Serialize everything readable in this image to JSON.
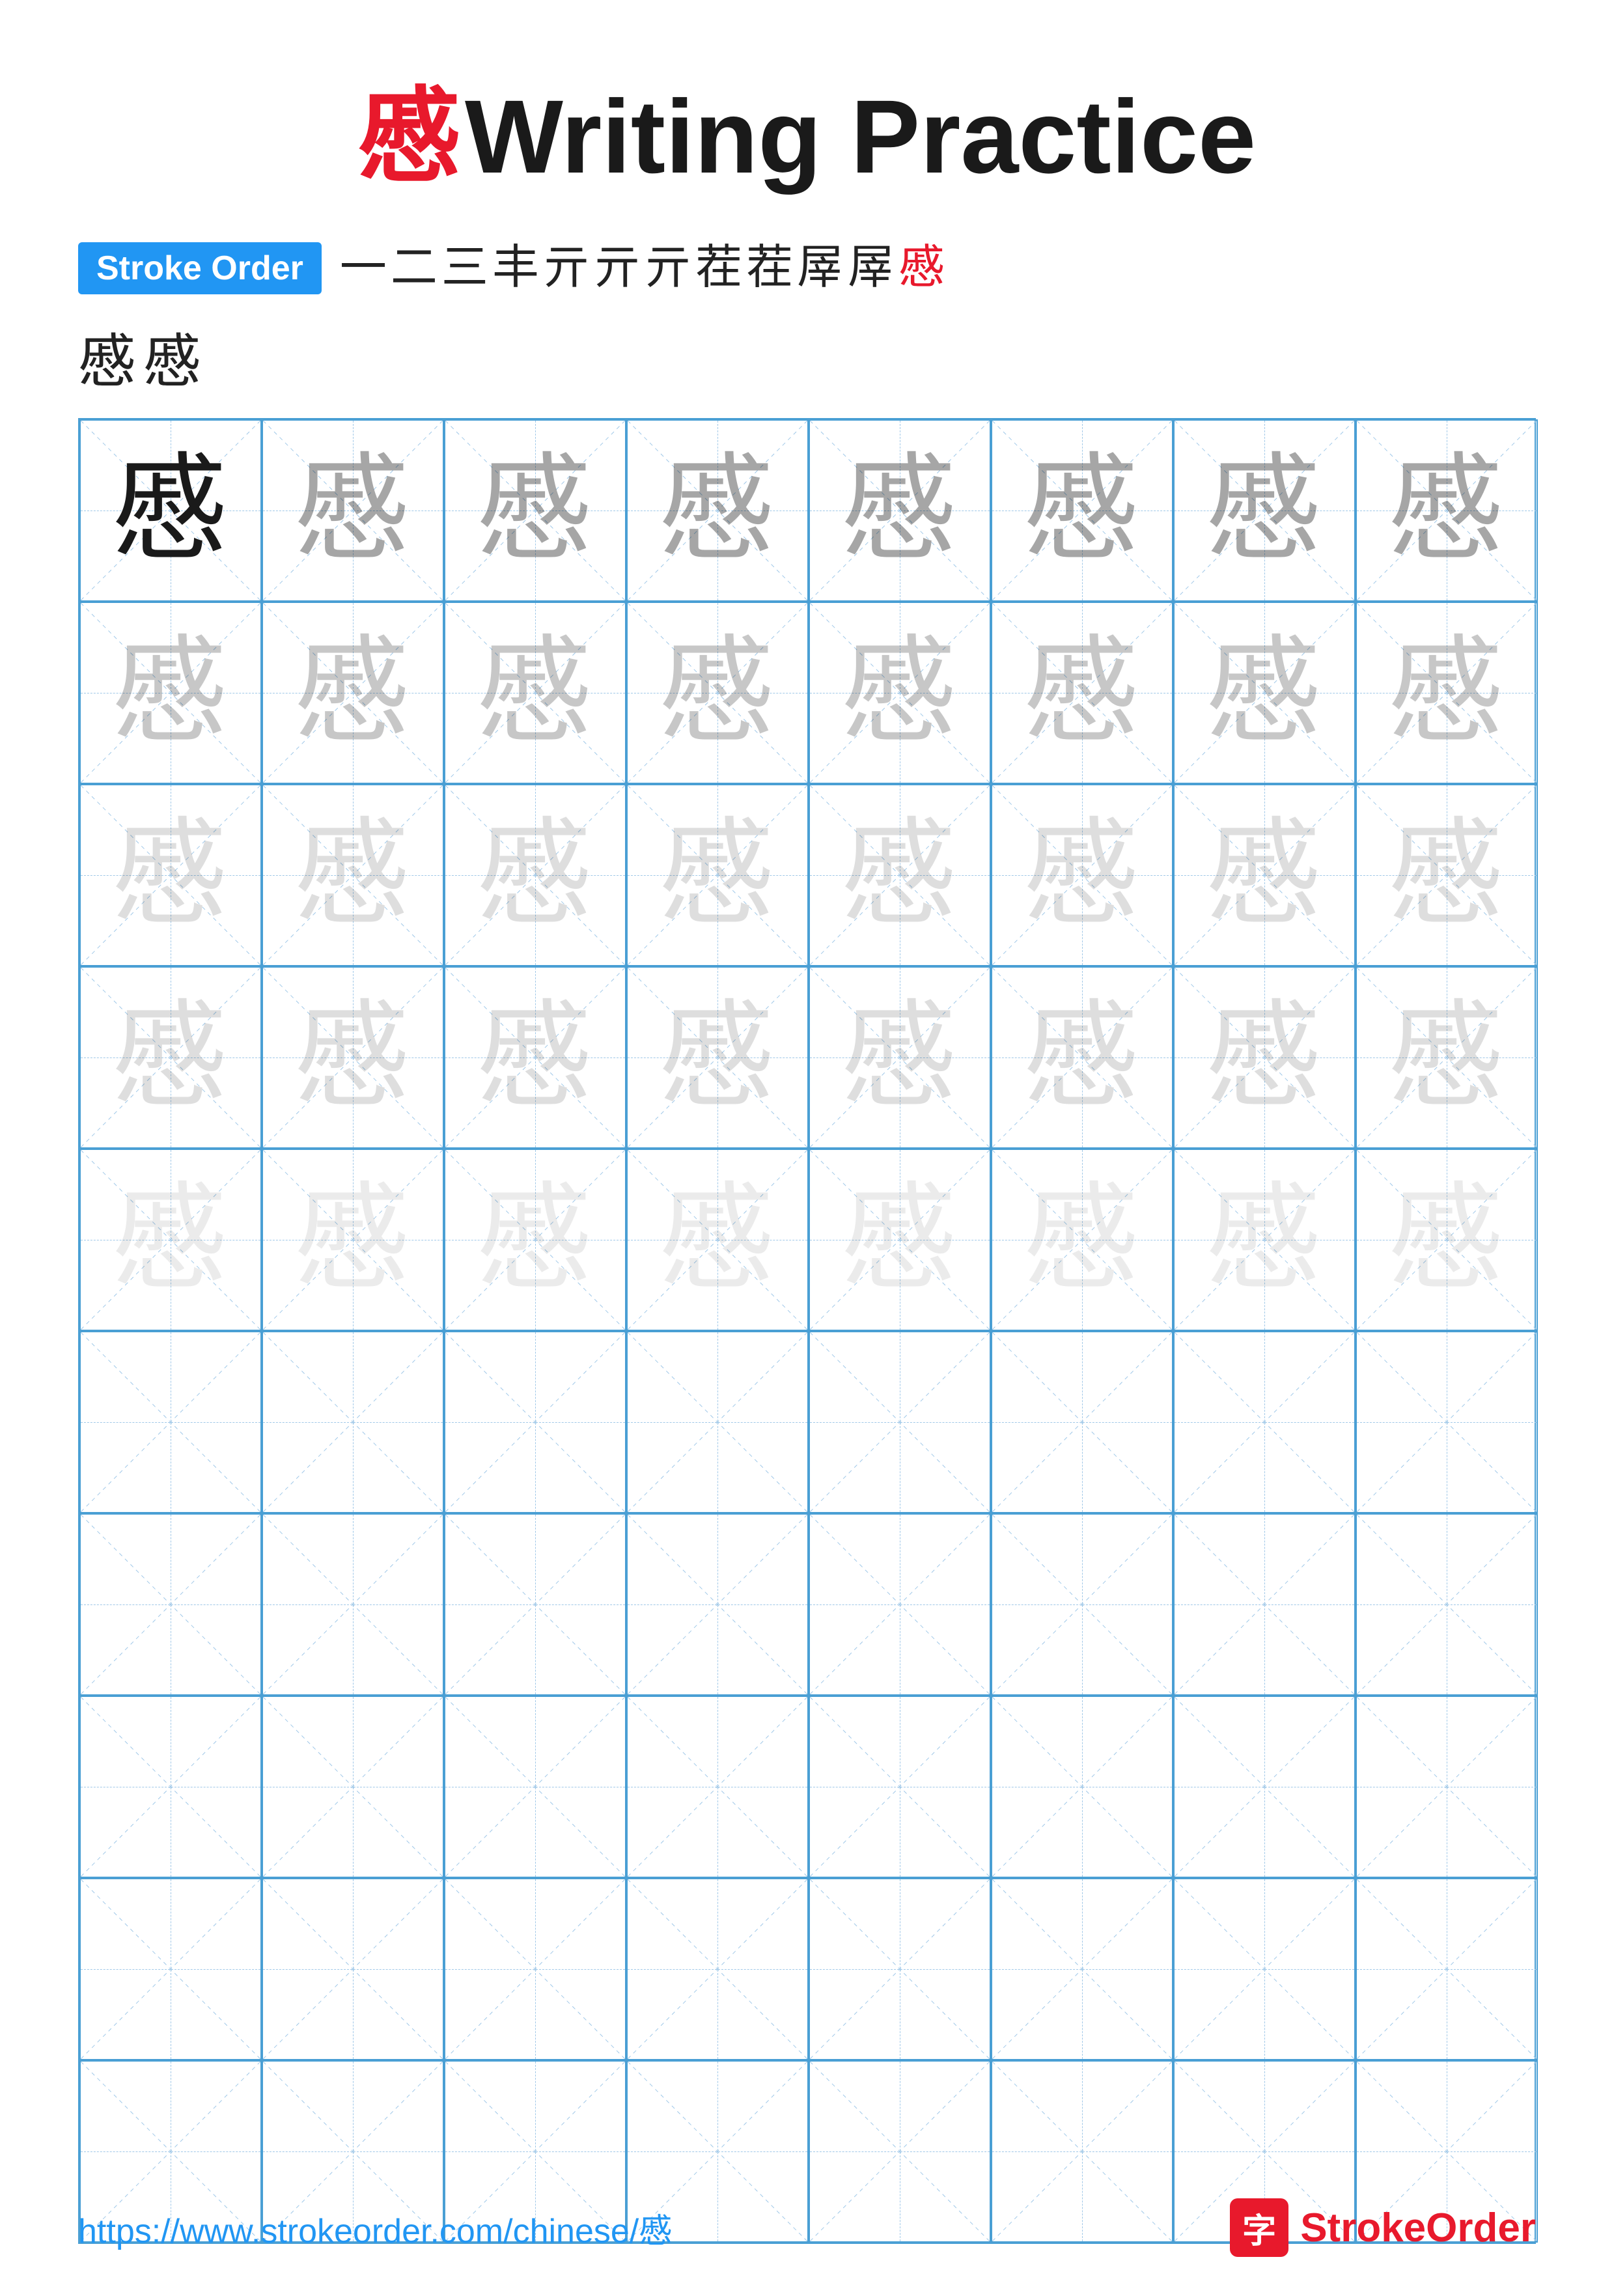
{
  "title": {
    "char": "慼",
    "text": " Writing Practice"
  },
  "stroke_order": {
    "badge_label": "Stroke Order",
    "strokes": [
      "一",
      "二",
      "三",
      "丰",
      "亓",
      "亓",
      "亓",
      "茬",
      "茬",
      "屖",
      "屖",
      "慼"
    ],
    "extra_chars": [
      "慼",
      "慼"
    ]
  },
  "practice": {
    "char": "慼",
    "rows": 10,
    "cols": 8,
    "filled_rows": 5,
    "opacity_levels": [
      "dark",
      "light1",
      "light2",
      "light3",
      "light4"
    ]
  },
  "footer": {
    "url": "https://www.strokeorder.com/chinese/慼",
    "logo_char": "字",
    "logo_text_stroke": "Stroke",
    "logo_text_order": "Order"
  }
}
